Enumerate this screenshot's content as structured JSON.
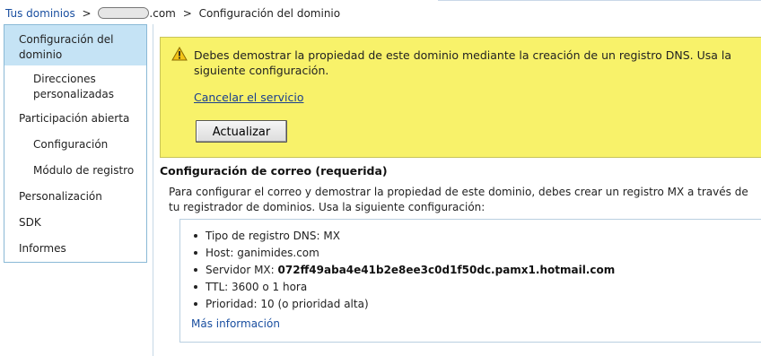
{
  "breadcrumb": {
    "root_link": "Tus dominios",
    "separator": ">",
    "domain_suffix": ".com",
    "current": "Configuración del dominio"
  },
  "sidebar": {
    "items": [
      {
        "label": "Configuración del dominio",
        "selected": true
      },
      {
        "label": "Direcciones personalizadas",
        "selected": false
      },
      {
        "label": "Participación abierta",
        "selected": false
      },
      {
        "label": "Configuración",
        "selected": false
      },
      {
        "label": "Módulo de registro",
        "selected": false
      },
      {
        "label": "Personalización",
        "selected": false
      },
      {
        "label": "SDK",
        "selected": false
      },
      {
        "label": "Informes",
        "selected": false
      }
    ]
  },
  "alert": {
    "icon": "warning-icon",
    "message": "Debes demostrar la propiedad de este dominio mediante la creación de un registro DNS. Usa la siguiente configuración.",
    "cancel_link": "Cancelar el servicio",
    "update_button": "Actualizar",
    "background_color": "#f8f26a"
  },
  "mail_config": {
    "title": "Configuración de correo (requerida)",
    "description": "Para configurar el correo y demostrar la propiedad de este dominio, debes crear un registro MX a través de tu registrador de dominios. Usa la siguiente configuración:",
    "items": [
      {
        "label": "Tipo de registro DNS:",
        "value": "MX"
      },
      {
        "label": "Host:",
        "value": "ganimides.com"
      },
      {
        "label": "Servidor MX:",
        "value": "072ff49aba4e41b2e8ee3c0d1f50dc.pamx1.hotmail.com"
      },
      {
        "label": "TTL:",
        "value": "3600 o 1 hora"
      },
      {
        "label": "Prioridad:",
        "value": "10 (o prioridad alta)"
      }
    ],
    "more_info_link": "Más información"
  },
  "colors": {
    "link": "#1a4fa0",
    "sidebar_selected": "#c5e3f5",
    "border": "#8ab9d6"
  }
}
